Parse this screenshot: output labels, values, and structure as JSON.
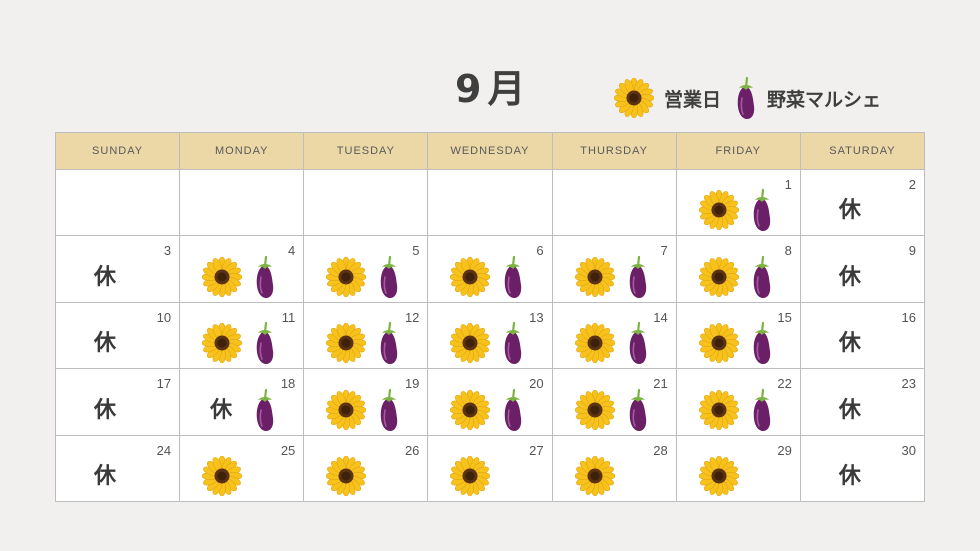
{
  "calendar": {
    "month_title": "9月",
    "legend": [
      {
        "icon": "sunflower-icon",
        "label": "営業日"
      },
      {
        "icon": "eggplant-icon",
        "label": "野菜マルシェ"
      }
    ],
    "weekdays": [
      "SUNDAY",
      "MONDAY",
      "TUESDAY",
      "WEDNESDAY",
      "THURSDAY",
      "FRIDAY",
      "SATURDAY"
    ],
    "closed_label": "休",
    "weeks": [
      [
        null,
        null,
        null,
        null,
        null,
        {
          "day": "1",
          "marks": [
            "sunflower",
            "eggplant"
          ]
        },
        {
          "day": "2",
          "marks": [
            "closed"
          ]
        }
      ],
      [
        {
          "day": "3",
          "marks": [
            "closed"
          ]
        },
        {
          "day": "4",
          "marks": [
            "sunflower",
            "eggplant"
          ]
        },
        {
          "day": "5",
          "marks": [
            "sunflower",
            "eggplant"
          ]
        },
        {
          "day": "6",
          "marks": [
            "sunflower",
            "eggplant"
          ]
        },
        {
          "day": "7",
          "marks": [
            "sunflower",
            "eggplant"
          ]
        },
        {
          "day": "8",
          "marks": [
            "sunflower",
            "eggplant"
          ]
        },
        {
          "day": "9",
          "marks": [
            "closed"
          ]
        }
      ],
      [
        {
          "day": "10",
          "marks": [
            "closed"
          ]
        },
        {
          "day": "11",
          "marks": [
            "sunflower",
            "eggplant"
          ]
        },
        {
          "day": "12",
          "marks": [
            "sunflower",
            "eggplant"
          ]
        },
        {
          "day": "13",
          "marks": [
            "sunflower",
            "eggplant"
          ]
        },
        {
          "day": "14",
          "marks": [
            "sunflower",
            "eggplant"
          ]
        },
        {
          "day": "15",
          "marks": [
            "sunflower",
            "eggplant"
          ]
        },
        {
          "day": "16",
          "marks": [
            "closed"
          ]
        }
      ],
      [
        {
          "day": "17",
          "marks": [
            "closed"
          ]
        },
        {
          "day": "18",
          "marks": [
            "closed",
            "eggplant"
          ]
        },
        {
          "day": "19",
          "marks": [
            "sunflower",
            "eggplant"
          ]
        },
        {
          "day": "20",
          "marks": [
            "sunflower",
            "eggplant"
          ]
        },
        {
          "day": "21",
          "marks": [
            "sunflower",
            "eggplant"
          ]
        },
        {
          "day": "22",
          "marks": [
            "sunflower",
            "eggplant"
          ]
        },
        {
          "day": "23",
          "marks": [
            "closed"
          ]
        }
      ],
      [
        {
          "day": "24",
          "marks": [
            "closed"
          ]
        },
        {
          "day": "25",
          "marks": [
            "sunflower"
          ]
        },
        {
          "day": "26",
          "marks": [
            "sunflower"
          ]
        },
        {
          "day": "27",
          "marks": [
            "sunflower"
          ]
        },
        {
          "day": "28",
          "marks": [
            "sunflower"
          ]
        },
        {
          "day": "29",
          "marks": [
            "sunflower"
          ]
        },
        {
          "day": "30",
          "marks": [
            "closed"
          ]
        }
      ]
    ]
  },
  "colors": {
    "page_background": "#f1f0ee",
    "header_background": "#ecd7a6",
    "cell_background": "#ffffff",
    "grid_line": "#bdbdbd",
    "title_text": "#3f3f3f",
    "sunflower_petal": "#f7c21c",
    "sunflower_center": "#5b3312",
    "eggplant_body": "#6a1f66",
    "eggplant_stem": "#7cb342"
  }
}
